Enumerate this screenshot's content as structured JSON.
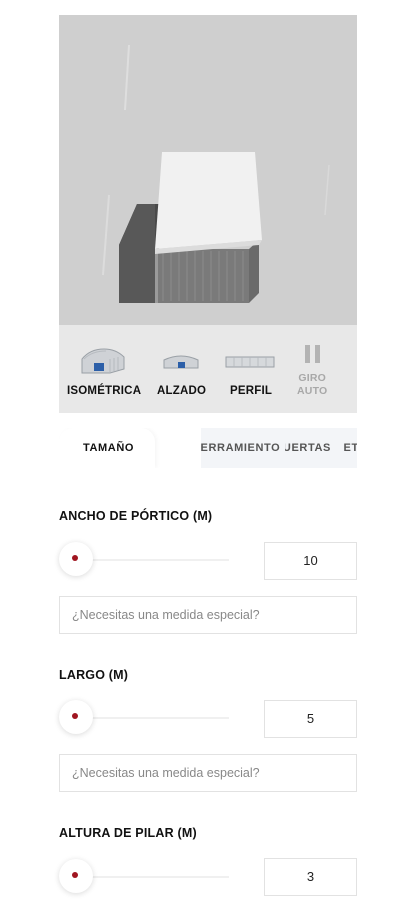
{
  "viewer": {
    "colors": {
      "ground": "#cfcfcf",
      "roof": "#f2f2f2",
      "wall": "#777777",
      "shadow": "#4a4a4a"
    }
  },
  "view_modes": [
    {
      "label": "ISOMÉTRICA",
      "icon": "isometric-view-icon",
      "selected": true
    },
    {
      "label": "ALZADO",
      "icon": "elevation-view-icon",
      "selected": false
    },
    {
      "label": "PERFIL",
      "icon": "profile-view-icon",
      "selected": false
    }
  ],
  "auto_rotate": {
    "line1": "GIRO",
    "line2": "AUTO",
    "icon": "pause-icon"
  },
  "tabs": [
    {
      "label": "TAMAÑO",
      "active": true
    },
    {
      "label": "CERRAMIENTO",
      "active": false
    },
    {
      "label": "PUERTAS",
      "active": false
    },
    {
      "label": "DETALLES",
      "active": false
    }
  ],
  "fields": [
    {
      "title": "ANCHO DE PÓRTICO (M)",
      "value": "10",
      "placeholder": "¿Necesitas una medida especial?"
    },
    {
      "title": "LARGO (M)",
      "value": "5",
      "placeholder": "¿Necesitas una medida especial?"
    },
    {
      "title": "ALTURA DE PILAR (M)",
      "value": "3"
    }
  ],
  "colors": {
    "accent": "#a01520",
    "toolbar_bg": "#e8e8e8",
    "tab_bg": "#f3f5f8"
  }
}
